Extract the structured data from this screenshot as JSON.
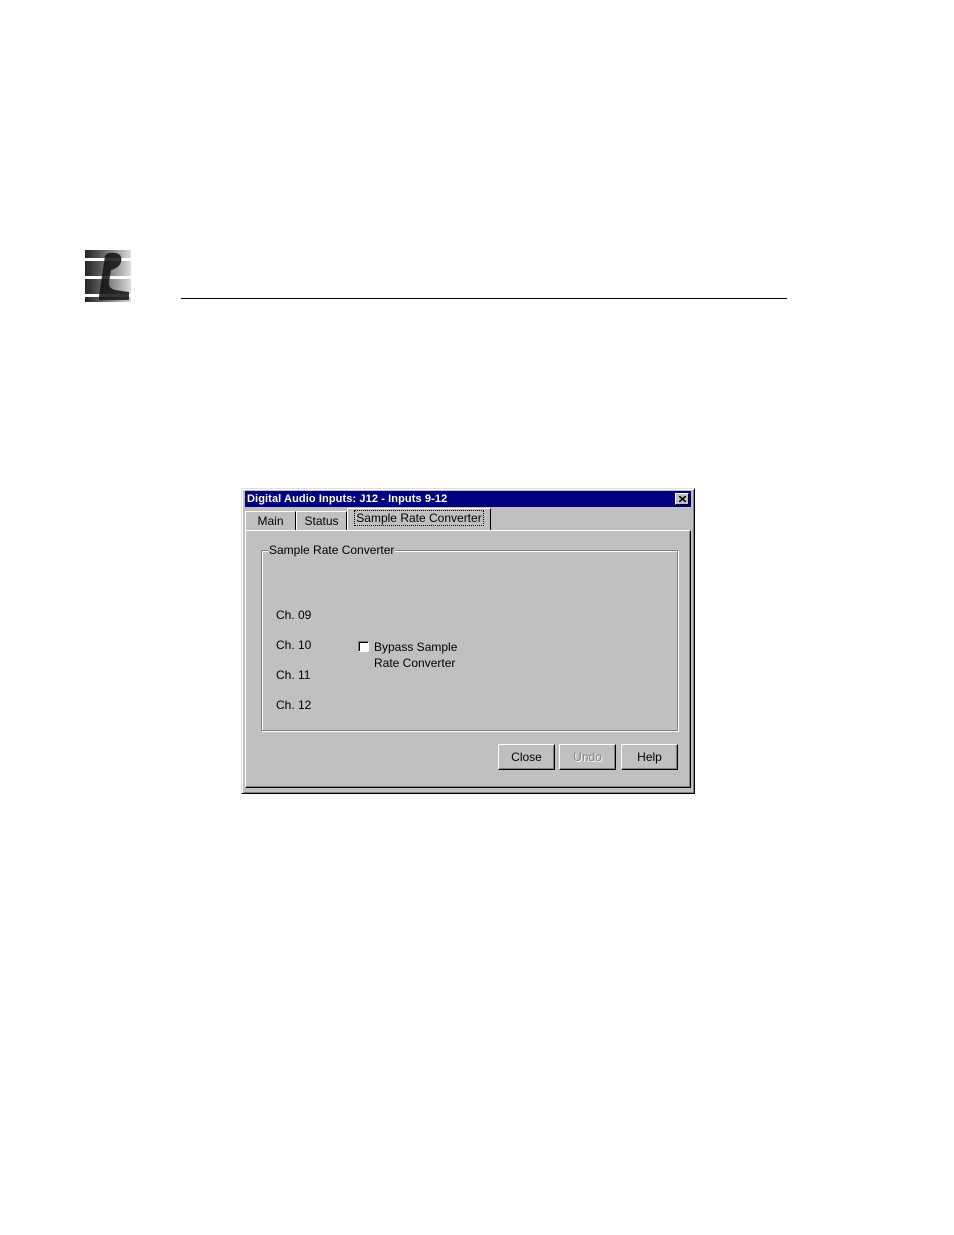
{
  "dialog": {
    "title": "Digital Audio Inputs: J12 - Inputs 9-12",
    "tabs": [
      {
        "label": "Main"
      },
      {
        "label": "Status"
      },
      {
        "label": "Sample Rate Converter"
      }
    ],
    "active_tab": "Sample Rate Converter",
    "group": {
      "legend": "Sample Rate Converter",
      "channels": [
        "Ch. 09",
        "Ch. 10",
        "Ch. 11",
        "Ch. 12"
      ],
      "bypass_checkbox": {
        "label_line1": "Bypass Sample",
        "label_line2": "Rate Converter",
        "checked": false
      }
    },
    "buttons": {
      "close": "Close",
      "undo": "Undo",
      "help": "Help"
    }
  },
  "colors": {
    "titlebar": "#000080",
    "face": "#c0c0c0"
  }
}
